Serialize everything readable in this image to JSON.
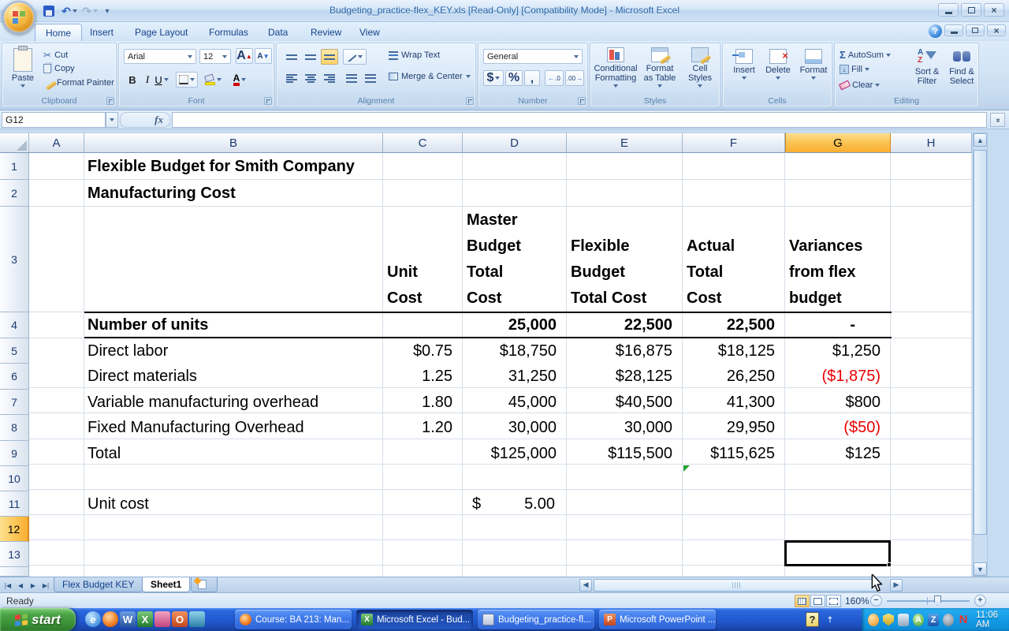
{
  "window": {
    "title": "Budgeting_practice-flex_KEY.xls  [Read-Only]  [Compatibility Mode] - Microsoft Excel"
  },
  "qat": {
    "undo_glyph": "↶",
    "redo_glyph": "↷"
  },
  "ribbon": {
    "tabs": [
      "Home",
      "Insert",
      "Page Layout",
      "Formulas",
      "Data",
      "Review",
      "View"
    ],
    "clipboard": {
      "label": "Clipboard",
      "paste": "Paste",
      "cut": "Cut",
      "copy": "Copy",
      "format_painter": "Format Painter",
      "cut_glyph": "✂"
    },
    "font": {
      "label": "Font",
      "family": "Arial",
      "size": "12",
      "bold_glyph": "B",
      "italic_glyph": "I",
      "underline_glyph": "U",
      "grow_glyph": "A",
      "shrink_glyph": "A",
      "color_glyph": "A"
    },
    "alignment": {
      "label": "Alignment",
      "wrap": "Wrap Text",
      "merge": "Merge & Center"
    },
    "number": {
      "label": "Number",
      "format": "General",
      "currency_glyph": "$",
      "percent_glyph": "%",
      "comma_glyph": ",",
      "inc_glyph": ".0",
      "dec_glyph": ".00"
    },
    "styles": {
      "label": "Styles",
      "conditional": "Conditional\nFormatting",
      "format_table": "Format\nas Table",
      "cell_styles": "Cell\nStyles"
    },
    "cells": {
      "label": "Cells",
      "insert": "Insert",
      "delete": "Delete",
      "format": "Format"
    },
    "editing": {
      "label": "Editing",
      "autosum": "AutoSum",
      "autosum_glyph": "Σ",
      "fill": "Fill",
      "clear": "Clear",
      "sort": "Sort &\nFilter",
      "find": "Find &\nSelect"
    }
  },
  "formula_bar": {
    "name_box": "G12",
    "fx": "fx"
  },
  "grid": {
    "columns": [
      "A",
      "B",
      "C",
      "D",
      "E",
      "F",
      "G",
      "H"
    ],
    "rows": [
      "1",
      "2",
      "3",
      "4",
      "5",
      "6",
      "7",
      "8",
      "9",
      "10",
      "11",
      "12",
      "13"
    ],
    "title1": "Flexible Budget for Smith Company",
    "title2": "Manufacturing Cost",
    "headers": {
      "unit": "Unit\nCost",
      "master": "Master\nBudget\nTotal\nCost",
      "flexible": "Flexible\nBudget\nTotal Cost",
      "actual": "Actual\nTotal\nCost",
      "variance": "Variances\nfrom flex\nbudget"
    },
    "r4": {
      "label": "Number of units",
      "d": "25,000",
      "e": "22,500",
      "f": "22,500",
      "g": "-"
    },
    "r5": {
      "label": "Direct labor",
      "c": "$0.75",
      "d": "$18,750",
      "e": "$16,875",
      "f": "$18,125",
      "g": "$1,250"
    },
    "r6": {
      "label": "Direct materials",
      "c": "1.25",
      "d": "31,250",
      "e": "$28,125",
      "f": "26,250",
      "g": "($1,875)"
    },
    "r7": {
      "label": "Variable manufacturing overhead",
      "c": "1.80",
      "d": "45,000",
      "e": "$40,500",
      "f": "41,300",
      "g": "$800"
    },
    "r8": {
      "label": "Fixed Manufacturing Overhead",
      "c": "1.20",
      "d": "30,000",
      "e": "30,000",
      "f": "29,950",
      "g": "($50)"
    },
    "r9": {
      "label": "Total",
      "d": "$125,000",
      "e": "$115,500",
      "f": "$115,625",
      "g": "$125"
    },
    "r11": {
      "label": "Unit cost",
      "d_currency": "$",
      "d_value": "5.00"
    }
  },
  "sheet_bar": {
    "tabs": [
      "Flex Budget KEY",
      "Sheet1"
    ]
  },
  "status_bar": {
    "mode": "Ready",
    "zoom": "160%"
  },
  "taskbar": {
    "start": "start",
    "quick_launch": [
      {
        "name": "internet-explorer",
        "glyph": "e"
      },
      {
        "name": "firefox",
        "glyph": ""
      },
      {
        "name": "word",
        "glyph": "W"
      },
      {
        "name": "excel",
        "glyph": "X"
      },
      {
        "name": "key",
        "glyph": ""
      },
      {
        "name": "outlook",
        "glyph": "O"
      },
      {
        "name": "messenger",
        "glyph": ""
      }
    ],
    "tasks": [
      {
        "icon": "firefox",
        "label": "Course: BA 213: Man..."
      },
      {
        "icon": "excel",
        "label": "Microsoft Excel - Bud..."
      },
      {
        "icon": "document",
        "label": "Budgeting_practice-fl..."
      },
      {
        "icon": "powerpoint",
        "label": "Microsoft PowerPoint ..."
      }
    ],
    "tray_glyphs": {
      "antivirus": "A",
      "zonealarm": "Z",
      "netscape": "N"
    },
    "clock": "11:06 AM"
  }
}
